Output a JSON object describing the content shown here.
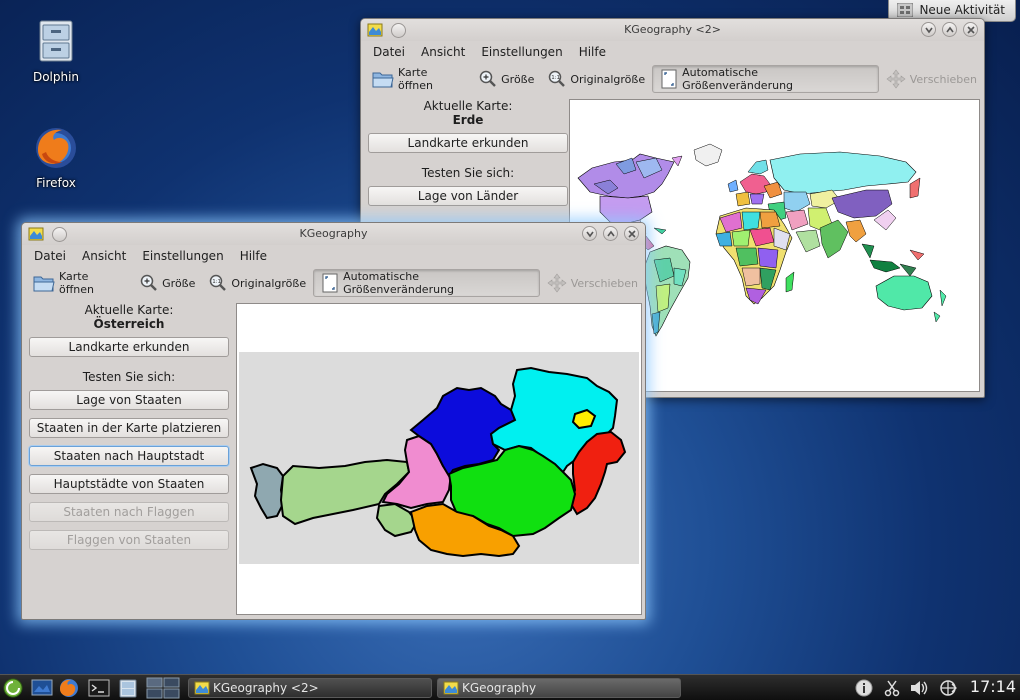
{
  "desktop": {
    "icons": [
      {
        "label": "Dolphin",
        "icon": "file-cabinet-icon"
      },
      {
        "label": "Firefox",
        "icon": "firefox-icon"
      }
    ],
    "activity_button": "Neue Aktivität"
  },
  "windows": [
    {
      "title": "KGeography <2>",
      "menu": [
        "Datei",
        "Ansicht",
        "Einstellungen",
        "Hilfe"
      ],
      "toolbar": {
        "open_map": "Karte öffnen",
        "zoom": "Größe",
        "original_size": "Originalgröße",
        "auto_resize": "Automatische Größenveränderung",
        "move": "Verschieben"
      },
      "current_map_label": "Aktuelle Karte:",
      "current_map": "Erde",
      "explore_button": "Landkarte erkunden",
      "test_label": "Testen Sie sich:",
      "quiz_buttons": [
        "Lage von Länder"
      ]
    },
    {
      "title": "KGeography",
      "menu": [
        "Datei",
        "Ansicht",
        "Einstellungen",
        "Hilfe"
      ],
      "toolbar": {
        "open_map": "Karte öffnen",
        "zoom": "Größe",
        "original_size": "Originalgröße",
        "auto_resize": "Automatische Größenveränderung",
        "move": "Verschieben"
      },
      "current_map_label": "Aktuelle Karte:",
      "current_map": "Österreich",
      "explore_button": "Landkarte erkunden",
      "test_label": "Testen Sie sich:",
      "quiz_buttons": [
        "Lage von Staaten",
        "Staaten in der Karte platzieren",
        "Staaten nach Hauptstadt",
        "Hauptstädte von Staaten",
        "Staaten nach Flaggen",
        "Flaggen von Staaten"
      ]
    }
  ],
  "map_colors": {
    "austria_background": "#dcdcdc",
    "vorarlberg": "#8fa8b0",
    "tirol": "#a5d68d",
    "salzburg": "#f08cd0",
    "oberoesterreich": "#0c0cdc",
    "niederoesterreich": "#00f0f0",
    "wien": "#ffee00",
    "burgenland": "#f02010",
    "steiermark": "#10e010",
    "kaernten": "#f8a000",
    "osttirol": "#a5d68d"
  },
  "taskbar": {
    "tasks": [
      "KGeography <2>",
      "KGeography"
    ],
    "clock": "17:14"
  }
}
